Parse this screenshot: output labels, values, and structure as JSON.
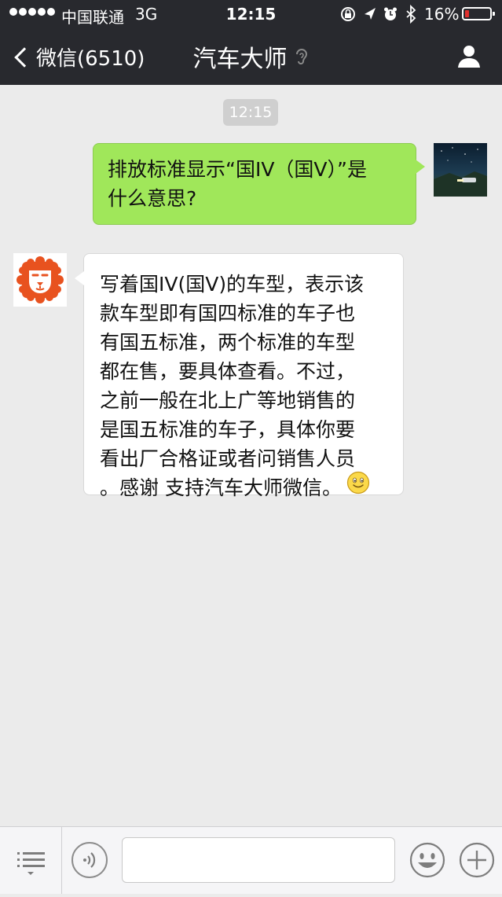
{
  "status_bar": {
    "carrier": "中国联通",
    "network": "3G",
    "time": "12:15",
    "battery_percent": "16%",
    "battery_level": 0.16,
    "icons": [
      "orientation-lock-icon",
      "location-icon",
      "alarm-icon",
      "bluetooth-icon"
    ]
  },
  "nav": {
    "back_label": "微信(6510)",
    "title": "汽车大师",
    "title_icon": "ear-icon",
    "right_icon": "profile-icon"
  },
  "chat": {
    "timestamp": "12:15",
    "messages": [
      {
        "side": "right",
        "bubble_color": "#a0e75a",
        "lines": [
          "排放标准显示“国IV（国V）”是",
          "什么意思?"
        ]
      },
      {
        "side": "left",
        "bubble_color": "#ffffff",
        "avatar_color": "#e8521f",
        "lines": [
          "写着国IV(国V)的车型，表示该",
          "款车型即有国四标准的车子也",
          "有国五标准，两个标准的车型",
          "都在售，要具体查看。不过，",
          "之前一般在北上广等地销售的",
          "是国五标准的车子，具体你要",
          "看出厂合格证或者问销售人员",
          "。感谢 支持汽车大师微信。"
        ],
        "trailing_icon": "smiley-emoji-icon"
      }
    ]
  },
  "input_bar": {
    "menu_icon": "list-menu-icon",
    "voice_icon": "voice-icon",
    "text_value": "",
    "emoji_icon": "emoji-icon",
    "plus_icon": "plus-icon"
  },
  "colors": {
    "header_bg": "#28292e",
    "chat_bg": "#ebebeb",
    "sent_bubble": "#a0e75a",
    "received_bubble": "#ffffff",
    "brand_orange": "#e8521f"
  }
}
